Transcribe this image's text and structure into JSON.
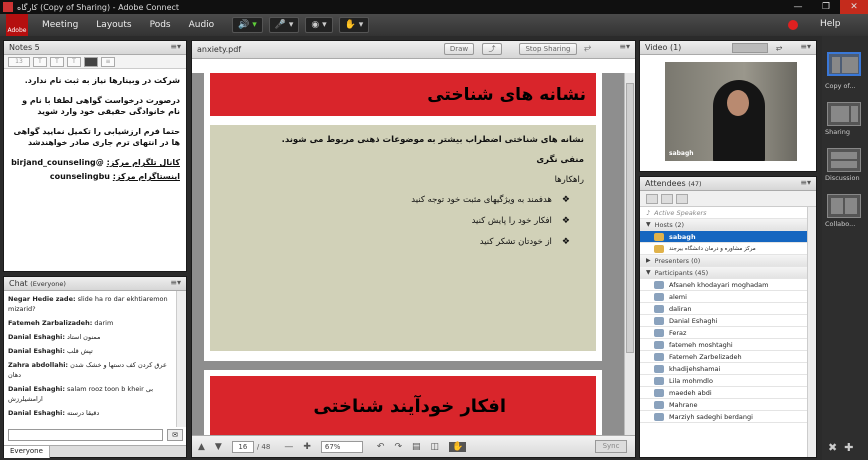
{
  "window": {
    "title": "کارگاه (Copy of Sharing) - Adobe Connect"
  },
  "menubar": {
    "logo": "Adobe",
    "items": [
      "Meeting",
      "Layouts",
      "Pods",
      "Audio"
    ],
    "help": "Help"
  },
  "notes": {
    "title": "Notes 5",
    "font_size": "13",
    "paragraphs": [
      "شرکت در وبینارها نیاز به ثبت نام ندارد.",
      "درصورت درخواست گواهی لطفا با نام و نام خانوادگی حقیقی خود وارد شوید",
      "حتما فرم ارزشیابی را تکمیل نمایید گواهی ها در انتهای ترم جاری صادر خواهندشد"
    ],
    "links": [
      {
        "label": "کانال تلگرام مرکز:",
        "value": "@birjand_counseling"
      },
      {
        "label": "اینستاگرام مرکز:",
        "value": "counselingbu"
      }
    ]
  },
  "chat": {
    "title": "Chat",
    "scope": "(Everyone)",
    "messages": [
      {
        "from": "Negar Hedie zade:",
        "text": "slide ha ro dar ekhtiaremon mizarid?"
      },
      {
        "from": "Fatemeh Zarbalizadeh:",
        "text": "darim"
      },
      {
        "from": "Danial Eshaghi:",
        "text": "ممنون استاد"
      },
      {
        "from": "Danial Eshaghi:",
        "text": "تپش قلب"
      },
      {
        "from": "Zahra abdollahi:",
        "text": "عرق کردن کف دستها و خشک شدن دهان"
      },
      {
        "from": "Danial Eshaghi:",
        "text": "salam  rooz  toon  b kheir  بی ارامشیلرزش"
      },
      {
        "from": "Danial Eshaghi:",
        "text": "دقیقا درسته"
      }
    ],
    "tab": "Everyone"
  },
  "share": {
    "file": "anxiety.pdf",
    "draw_label": "Draw",
    "stop_label": "Stop Sharing",
    "slide1": {
      "title": "نشانه های شناختی",
      "intro": "نشانه های شناختی اضطراب بیشتر به موضوعات ذهنی مربوط می شوند.",
      "sub": "منفی نگری",
      "sub2": "راهکارها",
      "bullets": [
        "هدفمند به ویژگیهای مثبت خود توجه کنید",
        "افکار خود را پایش کنید",
        "از خودتان تشکر کنید"
      ]
    },
    "slide2": {
      "title": "افکار خودآیند شناختی"
    },
    "page": "16",
    "total": "/ 48",
    "zoom": "67%",
    "sync_label": "Sync"
  },
  "video": {
    "title": "Video",
    "count": "(1)",
    "name": "sabagh"
  },
  "attendees": {
    "title": "Attendees",
    "count": "(47)",
    "active_speakers": "Active Speakers",
    "hosts_label": "Hosts (2)",
    "hosts": [
      "sabagh",
      "مرکز مشاوره و درمان دانشگاه بیرجند"
    ],
    "presenters_label": "Presenters (0)",
    "participants_label": "Participants (45)",
    "participants": [
      "Afsaneh khodayari moghadam",
      "alemi",
      "daliran",
      "Danial Eshaghi",
      "Feraz",
      "fatemeh moshtaghi",
      "Fatemeh Zarbelizadeh",
      "khadijehshamai",
      "Lila mohmdlo",
      "maedeh abdi",
      "Mahrane",
      "Marziyh sadeghi berdangi"
    ]
  },
  "rail": {
    "layouts": [
      "Copy of...",
      "Sharing",
      "Discussion",
      "Collabo..."
    ]
  }
}
